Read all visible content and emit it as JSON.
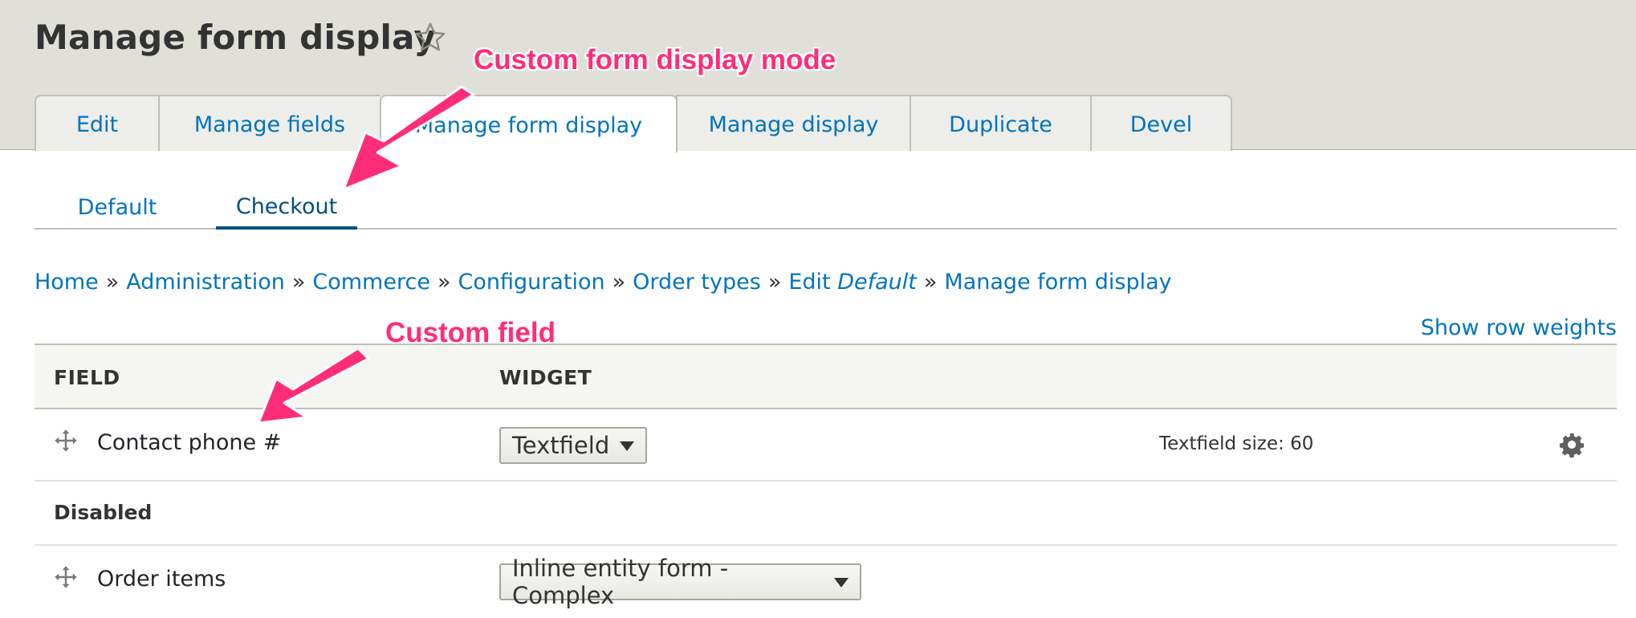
{
  "page": {
    "title": "Manage form display"
  },
  "tabs": [
    {
      "label": "Edit",
      "active": false
    },
    {
      "label": "Manage fields",
      "active": false
    },
    {
      "label": "Manage form display",
      "active": true
    },
    {
      "label": "Manage display",
      "active": false
    },
    {
      "label": "Duplicate",
      "active": false
    },
    {
      "label": "Devel",
      "active": false
    }
  ],
  "subtabs": [
    {
      "label": "Default",
      "active": false
    },
    {
      "label": "Checkout",
      "active": true
    }
  ],
  "breadcrumb": {
    "items": [
      "Home",
      "Administration",
      "Commerce",
      "Configuration",
      "Order types"
    ],
    "edit_prefix": "Edit",
    "edit_name": "Default",
    "last": "Manage form display",
    "separator": "»"
  },
  "table": {
    "show_row_weights": "Show row weights",
    "headers": {
      "field": "FIELD",
      "widget": "WIDGET"
    },
    "rows": [
      {
        "field": "Contact phone #",
        "widget": "Textfield",
        "summary": "Textfield size: 60"
      }
    ],
    "disabled_region": "Disabled",
    "disabled_rows": [
      {
        "field": "Order items",
        "widget": "Inline entity form - Complex"
      }
    ]
  },
  "annotations": {
    "mode": "Custom form display mode",
    "field": "Custom field",
    "color": "#ff2d78"
  },
  "icons": {
    "favorite": "star-outline-icon",
    "drag": "move-arrows-icon",
    "settings": "gear-icon"
  }
}
